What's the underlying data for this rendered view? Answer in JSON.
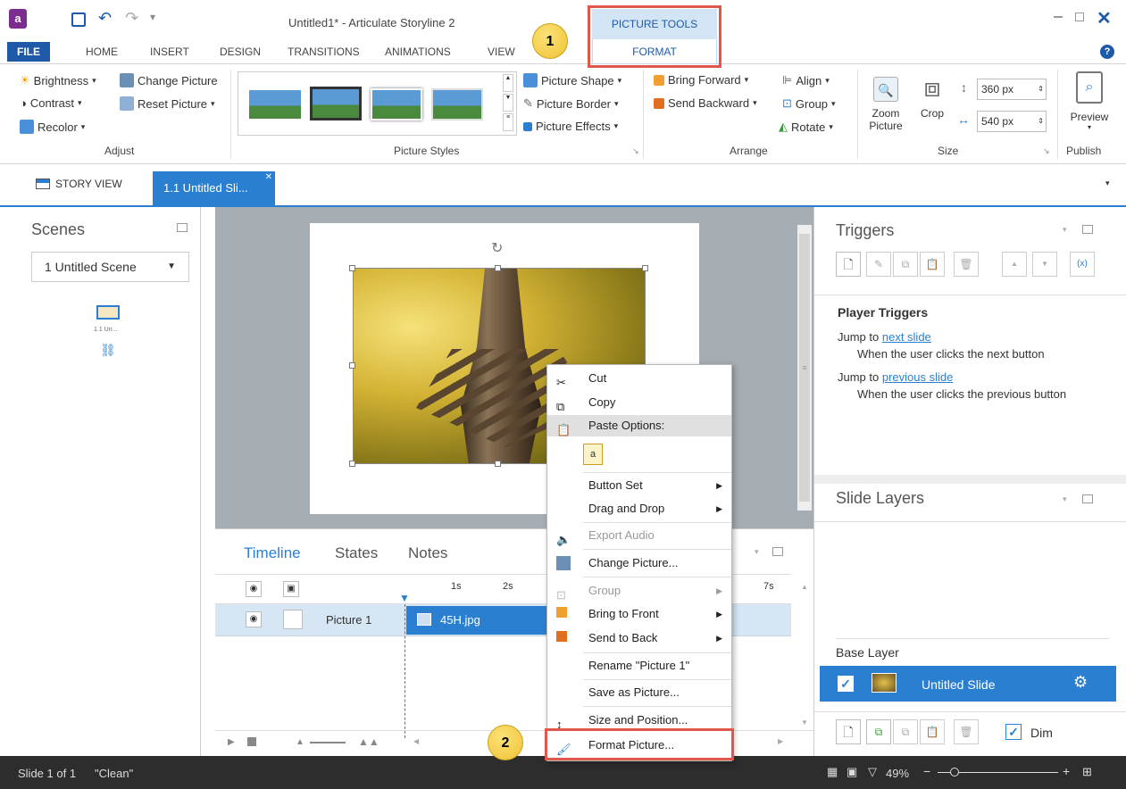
{
  "window": {
    "title": "Untitled1* - Articulate Storyline 2",
    "context_tab_group": "PICTURE TOOLS",
    "context_tab": "FORMAT"
  },
  "ribbon_tabs": [
    "FILE",
    "HOME",
    "INSERT",
    "DESIGN",
    "TRANSITIONS",
    "ANIMATIONS",
    "VIEW"
  ],
  "ribbon": {
    "adjust": {
      "brightness": "Brightness",
      "contrast": "Contrast",
      "recolor": "Recolor",
      "change_picture": "Change Picture",
      "reset_picture": "Reset Picture",
      "label": "Adjust"
    },
    "picture_styles": {
      "label": "Picture Styles",
      "shape": "Picture Shape",
      "border": "Picture Border",
      "effects": "Picture Effects"
    },
    "arrange": {
      "bring_forward": "Bring Forward",
      "send_backward": "Send Backward",
      "align": "Align",
      "group": "Group",
      "rotate": "Rotate",
      "label": "Arrange"
    },
    "size": {
      "zoom": "Zoom Picture",
      "crop": "Crop",
      "height": "360 px",
      "width": "540 px",
      "label": "Size"
    },
    "publish": {
      "preview": "Preview",
      "label": "Publish"
    }
  },
  "doc_tabs": {
    "story_view": "STORY VIEW",
    "slide_tab": "1.1 Untitled Sli..."
  },
  "scenes": {
    "title": "Scenes",
    "selector": "1 Untitled Scene",
    "thumb_label": "1.1 Un..."
  },
  "timeline": {
    "tabs": [
      "Timeline",
      "States",
      "Notes"
    ],
    "ticks": [
      "1s",
      "2s",
      "7s"
    ],
    "row_name": "Picture 1",
    "row_file": "45H.jpg"
  },
  "triggers": {
    "title": "Triggers",
    "player_title": "Player Triggers",
    "items": [
      {
        "prefix": "Jump to ",
        "link": "next slide",
        "desc": "When the user clicks the next button"
      },
      {
        "prefix": "Jump to ",
        "link": "previous slide",
        "desc": "When the user clicks the previous button"
      }
    ]
  },
  "layers": {
    "title": "Slide Layers",
    "base_label": "Base Layer",
    "base_slide": "Untitled Slide",
    "dim": "Dim"
  },
  "status": {
    "slide": "Slide 1 of 1",
    "theme": "\"Clean\"",
    "zoom": "49%"
  },
  "context_menu": {
    "cut": "Cut",
    "copy": "Copy",
    "paste_options": "Paste Options:",
    "button_set": "Button Set",
    "drag_drop": "Drag and Drop",
    "export_audio": "Export Audio",
    "change_picture": "Change Picture...",
    "group": "Group",
    "bring_front": "Bring to Front",
    "send_back": "Send to Back",
    "rename": "Rename \"Picture 1\"",
    "save_picture": "Save as Picture...",
    "size_position": "Size and Position...",
    "format_picture": "Format Picture..."
  },
  "callouts": {
    "one": "1",
    "two": "2"
  }
}
